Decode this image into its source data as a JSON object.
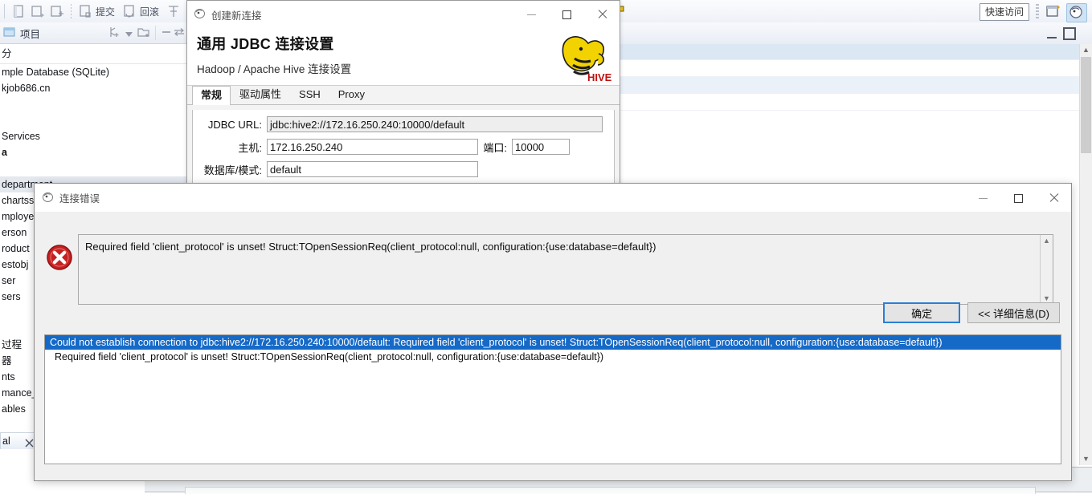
{
  "ide": {
    "toolbar": {
      "commit_label": "提交",
      "rollback_label": "回滚",
      "quick_access": "快速访问",
      "icons": [
        "commit-icon",
        "rollback-icon",
        "transaction-log-icon"
      ]
    },
    "project_view": {
      "title": "项目"
    },
    "tree": {
      "search_text": "分",
      "items": [
        {
          "label": "mple Database (SQLite)",
          "bold": false,
          "selected": false
        },
        {
          "label": "kjob686.cn",
          "bold": false,
          "selected": false
        },
        {
          "label": "",
          "bold": false,
          "selected": false
        },
        {
          "label": "",
          "bold": false,
          "selected": false
        },
        {
          "label": "Services",
          "bold": false,
          "selected": false
        },
        {
          "label": "a",
          "bold": true,
          "selected": false
        },
        {
          "label": "",
          "bold": false,
          "selected": false
        },
        {
          "label": "department",
          "bold": false,
          "selected": true
        },
        {
          "label": "chartss",
          "bold": false,
          "selected": false
        },
        {
          "label": "mployee",
          "bold": false,
          "selected": false
        },
        {
          "label": "erson",
          "bold": false,
          "selected": false
        },
        {
          "label": "roduct",
          "bold": false,
          "selected": false
        },
        {
          "label": "estobj",
          "bold": false,
          "selected": false
        },
        {
          "label": "ser",
          "bold": false,
          "selected": false
        },
        {
          "label": "sers",
          "bold": false,
          "selected": false
        },
        {
          "label": "",
          "bold": false,
          "selected": false
        },
        {
          "label": "",
          "bold": false,
          "selected": false
        },
        {
          "label": "过程",
          "bold": false,
          "selected": false
        },
        {
          "label": "器",
          "bold": false,
          "selected": false
        },
        {
          "label": "nts",
          "bold": false,
          "selected": false
        },
        {
          "label": "mance_",
          "bold": false,
          "selected": false
        },
        {
          "label": "ables",
          "bold": false,
          "selected": false
        }
      ],
      "bottom_tab_label": "al"
    }
  },
  "jdbc_dialog": {
    "window_title": "创建新连接",
    "heading": "通用 JDBC 连接设置",
    "subheading": "Hadoop / Apache Hive 连接设置",
    "logo_text": "HIVE",
    "tabs": [
      {
        "label": "常规",
        "active": true
      },
      {
        "label": "驱动属性",
        "active": false
      },
      {
        "label": "SSH",
        "active": false
      },
      {
        "label": "Proxy",
        "active": false
      }
    ],
    "fields": {
      "url_label": "JDBC URL:",
      "url_value": "jdbc:hive2://172.16.250.240:10000/default",
      "host_label": "主机:",
      "host_value": "172.16.250.240",
      "port_label": "端口:",
      "port_value": "10000",
      "db_label": "数据库/模式:",
      "db_value": "default"
    }
  },
  "error_dialog": {
    "window_title": "连接错误",
    "message": "Required field 'client_protocol' is unset! Struct:TOpenSessionReq(client_protocol:null, configuration:{use:database=default})",
    "ok_label": "确定",
    "details_label": "<< 详细信息(D)",
    "details_lines": [
      {
        "text": "Could not establish connection to jdbc:hive2://172.16.250.240:10000/default: Required field 'client_protocol' is unset! Struct:TOpenSessionReq(client_protocol:null, configuration:{use:database=default})",
        "selected": true,
        "indent": false
      },
      {
        "text": "Required field 'client_protocol' is unset! Struct:TOpenSessionReq(client_protocol:null, configuration:{use:database=default})",
        "selected": false,
        "indent": true
      }
    ]
  },
  "colors": {
    "selection_blue": "#1569c7",
    "error_red": "#c62020",
    "hive_yellow": "#f2d200",
    "default_button_border": "#2a7fd4"
  }
}
